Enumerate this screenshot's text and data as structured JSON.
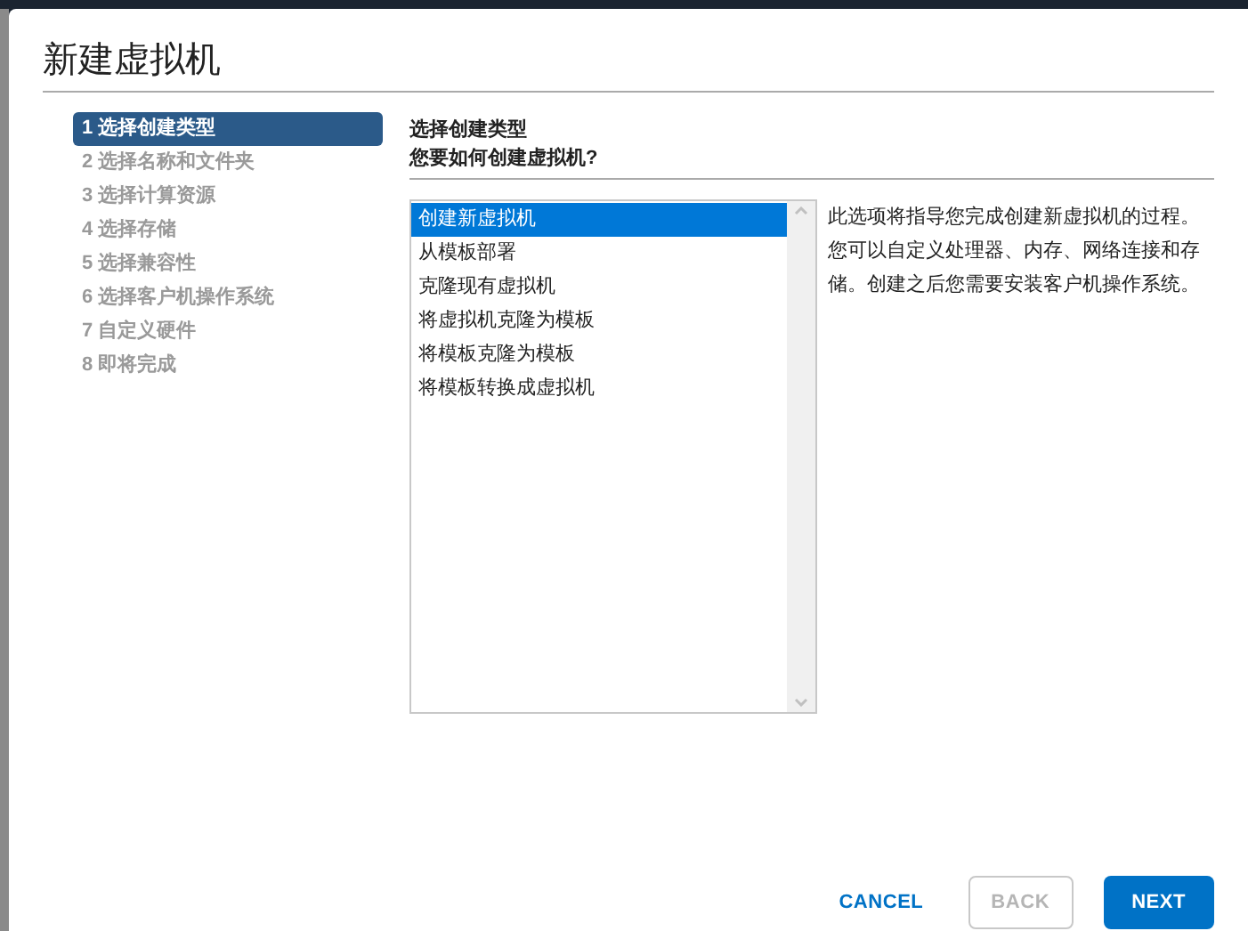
{
  "dialog": {
    "title": "新建虚拟机"
  },
  "steps": [
    {
      "label": "1 选择创建类型",
      "selected": true
    },
    {
      "label": "2 选择名称和文件夹",
      "selected": false
    },
    {
      "label": "3 选择计算资源",
      "selected": false
    },
    {
      "label": "4 选择存储",
      "selected": false
    },
    {
      "label": "5 选择兼容性",
      "selected": false
    },
    {
      "label": "6 选择客户机操作系统",
      "selected": false
    },
    {
      "label": "7 自定义硬件",
      "selected": false
    },
    {
      "label": "8 即将完成",
      "selected": false
    }
  ],
  "section": {
    "title": "选择创建类型",
    "question": "您要如何创建虚拟机?"
  },
  "options": [
    {
      "label": "创建新虚拟机",
      "selected": true
    },
    {
      "label": "从模板部署",
      "selected": false
    },
    {
      "label": "克隆现有虚拟机",
      "selected": false
    },
    {
      "label": "将虚拟机克隆为模板",
      "selected": false
    },
    {
      "label": "将模板克隆为模板",
      "selected": false
    },
    {
      "label": "将模板转换成虚拟机",
      "selected": false
    }
  ],
  "description": "此选项将指导您完成创建新虚拟机的过程。您可以自定义处理器、内存、网络连接和存储。创建之后您需要安装客户机操作系统。",
  "buttons": [
    {
      "label": "CANCEL",
      "kind": "link",
      "disabled": false
    },
    {
      "label": "BACK",
      "kind": "outline",
      "disabled": true
    },
    {
      "label": "NEXT",
      "kind": "primary",
      "disabled": false
    }
  ]
}
